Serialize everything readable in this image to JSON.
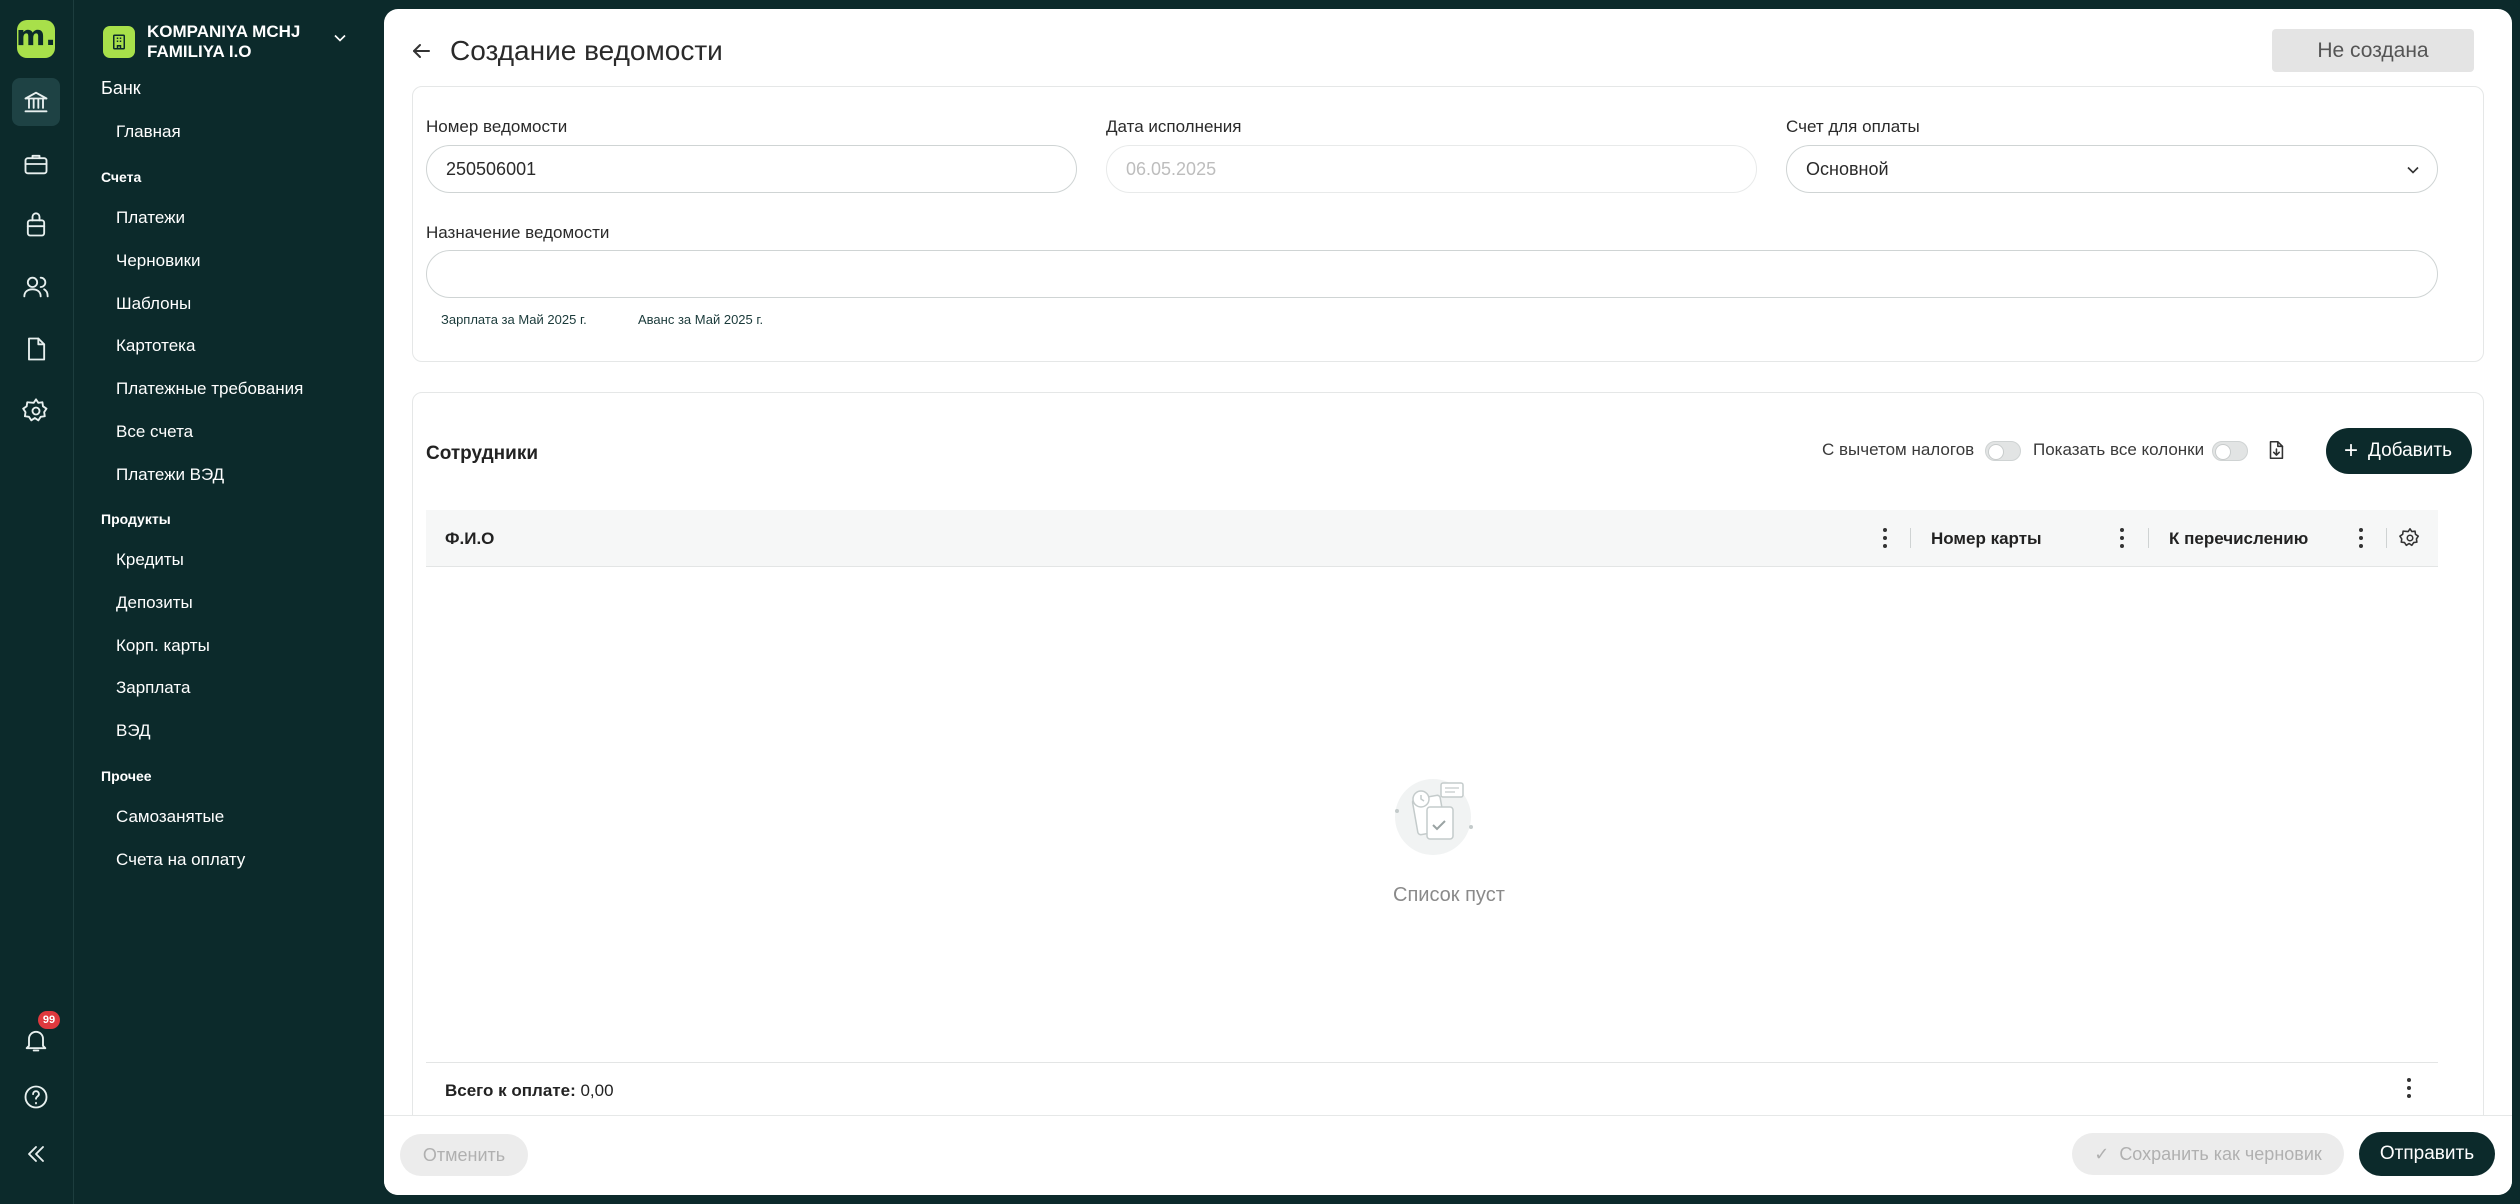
{
  "rail": {
    "notifications_count": "99",
    "icons": [
      "bank-icon",
      "briefcase-icon",
      "bag-icon",
      "users-icon",
      "document-icon",
      "settings-icon",
      "bell-icon",
      "help-icon",
      "collapse-icon"
    ]
  },
  "company": {
    "name": "KOMPANIYA MCHJ FAMILIYA I.O"
  },
  "nav": {
    "bank_heading": "Банк",
    "home": "Главная",
    "accounts_section": "Счета",
    "payments": "Платежи",
    "drafts": "Черновики",
    "templates": "Шаблоны",
    "card_index": "Картотека",
    "payment_requests": "Платежные требования",
    "all_accounts": "Все счета",
    "fea_payments": "Платежи ВЭД",
    "products_section": "Продукты",
    "credits": "Кредиты",
    "deposits": "Депозиты",
    "corp_cards": "Корп. карты",
    "salary": "Зарплата",
    "fea": "ВЭД",
    "other_section": "Прочее",
    "self_employed": "Самозанятые",
    "invoices": "Счета на оплату"
  },
  "header": {
    "title": "Создание ведомости",
    "status": "Не создана"
  },
  "form": {
    "number_label": "Номер ведомости",
    "number_value": "250506001",
    "date_label": "Дата исполнения",
    "date_value": "06.05.2025",
    "account_label": "Счет для оплаты",
    "account_value": "Основной",
    "purpose_label": "Назначение ведомости",
    "purpose_value": "",
    "suggestions": [
      "Зарплата за Май 2025 г.",
      "Аванс за Май 2025 г."
    ]
  },
  "employees": {
    "title": "Сотрудники",
    "toggle_taxes": "С вычетом налогов",
    "toggle_columns": "Показать все колонки",
    "add_label": "Добавить",
    "columns": [
      "Ф.И.О",
      "Номер карты",
      "К перечислению"
    ],
    "empty_text": "Список пуст",
    "total_label": "Всего к оплате:",
    "total_value": "0,00"
  },
  "footer": {
    "cancel": "Отменить",
    "save_draft": "Сохранить как черновик",
    "send": "Отправить"
  },
  "colors": {
    "brand_dark": "#0c2a2b",
    "brand_accent": "#a8e04a",
    "badge_red": "#e0393e"
  }
}
